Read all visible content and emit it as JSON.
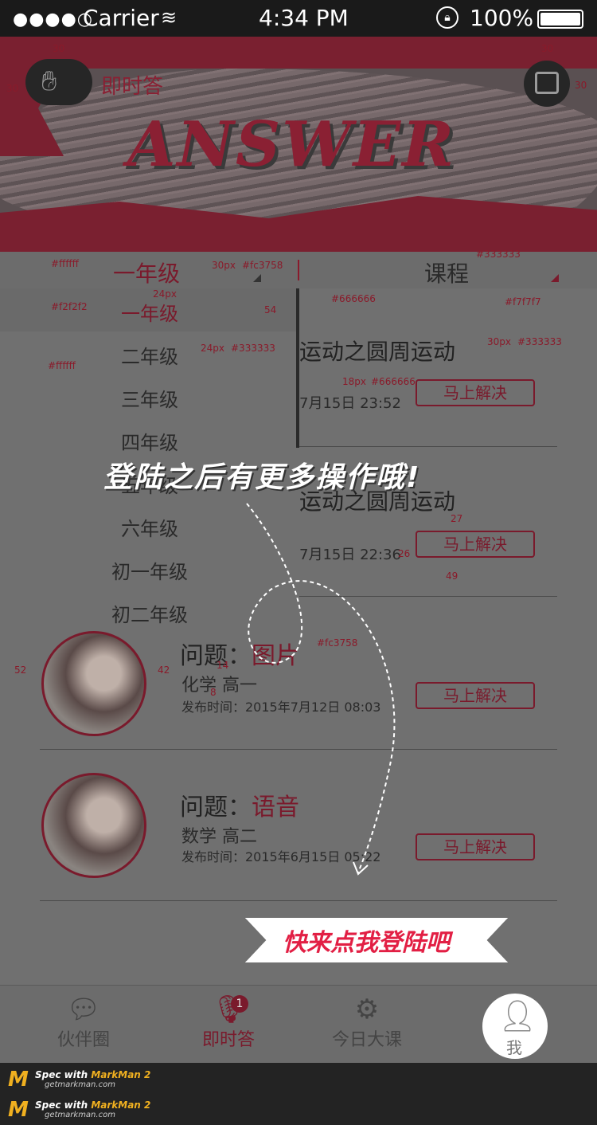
{
  "status_bar": {
    "signal": "●●●●○",
    "carrier": "Carrier",
    "time": "4:34 PM",
    "battery": "100%"
  },
  "header": {
    "brand": "即时答",
    "banner_title": "ANSWER",
    "ann": {
      "logo_top": "30",
      "logo_left": "30",
      "cal_top": "30",
      "cal_right": "30"
    }
  },
  "filters": {
    "grade": "一年级",
    "course": "课程",
    "ann": {
      "bg": "#ffffff",
      "size": "30px",
      "color": "#fc3758",
      "course_color": "#333333"
    }
  },
  "grades": {
    "items": [
      "一年级",
      "二年级",
      "三年级",
      "四年级",
      "五年级",
      "六年级",
      "初一年级",
      "初二年级"
    ],
    "ann": {
      "sel_bg": "#f2f2f2",
      "sel_size": "24px",
      "row_h": "54",
      "item_size": "24px",
      "item_color": "#333333",
      "list_bg": "#ffffff",
      "sep_color": "#666666",
      "right_bg": "#f7f7f7"
    }
  },
  "courses": [
    {
      "title": "运动之圆周运动",
      "time": "7月15日  23:52",
      "action": "马上解决"
    },
    {
      "title": "运动之圆周运动",
      "time": "7月15日  22:36",
      "action": "马上解决"
    }
  ],
  "course_ann": {
    "title_size": "30px",
    "title_color": "#333333",
    "time_size": "18px",
    "time_color": "#666666",
    "gap1": "27",
    "gap2": "26",
    "gap3": "49"
  },
  "questions": [
    {
      "label": "问题：",
      "tag": "图片",
      "sub": "化学   高一",
      "date": "发布时间：2015年7月12日  08:03",
      "action": "马上解决"
    },
    {
      "label": "问题：",
      "tag": "语音",
      "sub": "数学   高二",
      "date": "发布时间：2015年6月15日  05:22",
      "action": "马上解决"
    }
  ],
  "question_ann": {
    "left": "52",
    "gap": "42",
    "tag_color": "#fc3758",
    "v1": "14",
    "v2": "8"
  },
  "overlay": {
    "hint": "登陆之后有更多操作哦!",
    "login": "快来点我登陆吧"
  },
  "tabbar": {
    "tabs": [
      {
        "label": "伙伴圈",
        "icon": "chat-bubble-icon"
      },
      {
        "label": "即时答",
        "icon": "microphone-icon"
      },
      {
        "label": "今日大课",
        "icon": "film-reel-icon"
      },
      {
        "label": "我",
        "icon": "person-icon"
      }
    ],
    "badge": "1"
  },
  "markman": {
    "line": "Spec with",
    "brand": "MarkMan 2",
    "url": "getmarkman.com"
  },
  "colors": {
    "accent": "#fc3758",
    "dark_red": "#7a1a2c",
    "overlay": "#707070"
  }
}
